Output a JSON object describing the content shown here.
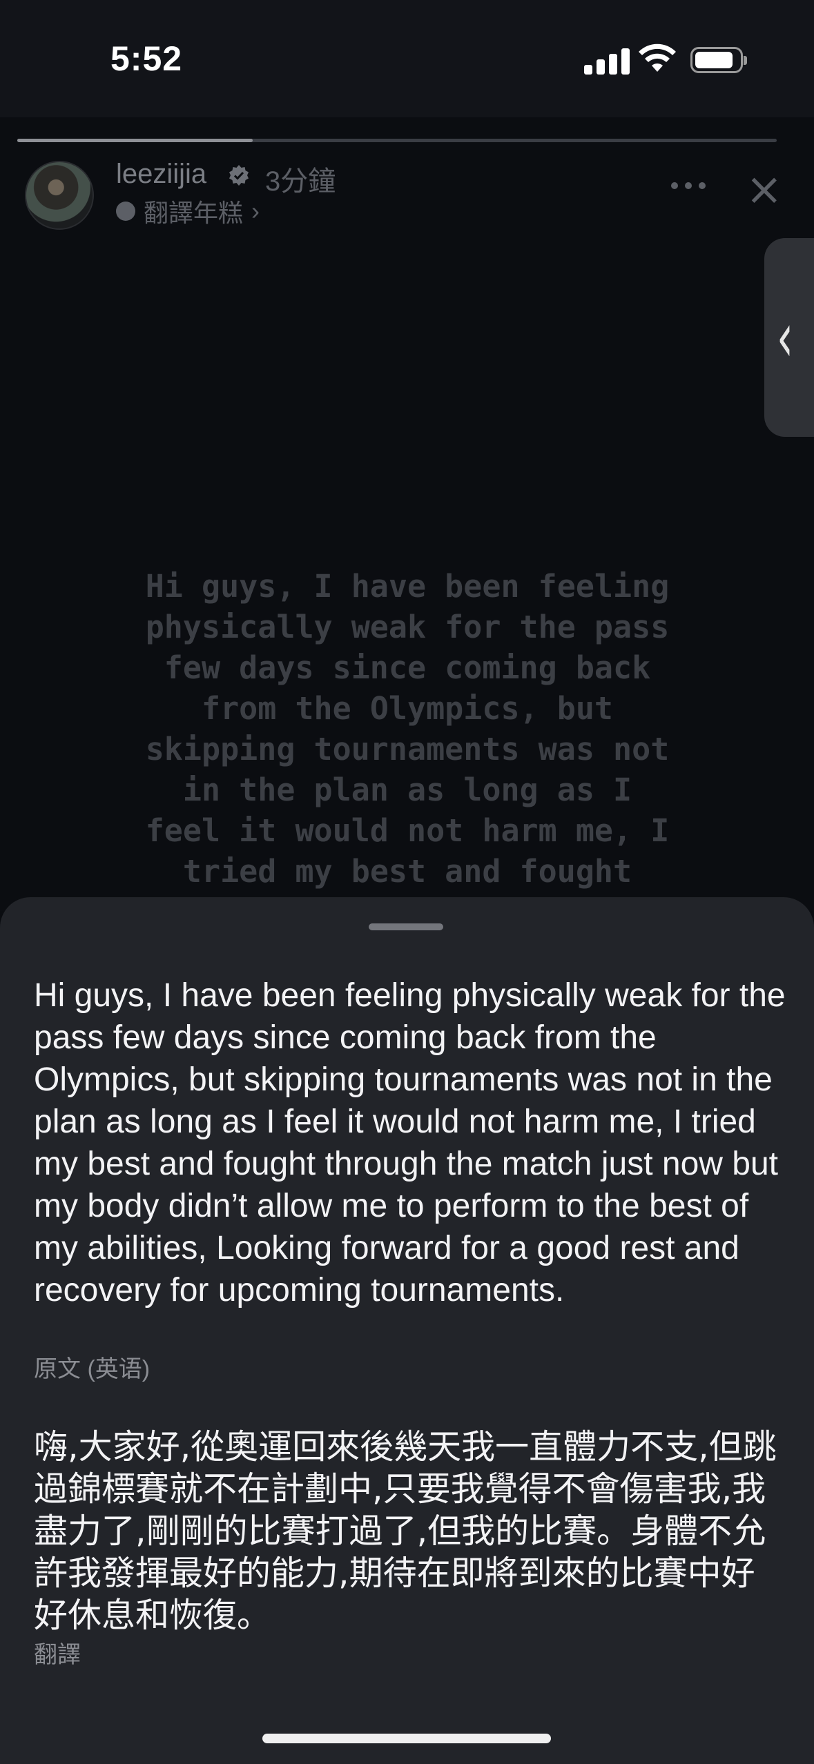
{
  "status_bar": {
    "time": "5:52",
    "icons": [
      "cellular-signal-icon",
      "wifi-icon",
      "battery-icon"
    ]
  },
  "story": {
    "progress": 0.31,
    "username": "leeziijia",
    "verified": true,
    "time_ago": "3分鐘",
    "audio_label": "翻譯年糕",
    "audio_chevron": "›",
    "close_symbol": "×",
    "side_tab_symbol": "‹",
    "text": "Hi guys, I have been feeling\nphysically weak for the pass\nfew days since coming back\nfrom the Olympics, but\nskipping tournaments was not\nin the plan as long as I\nfeel it would not harm me, I\ntried my best and fought"
  },
  "sheet": {
    "original_text": "Hi guys, I have been feeling physically weak for the pass few days since coming back from the Olympics, but skipping tournaments was not in the plan as long as I feel it would not harm me, I tried my best and fought through the match just now but my body didn’t allow me to perform to the best of my abilities, Looking forward for a good rest and recovery for upcoming tournaments.",
    "original_label": "原文 (英语)",
    "translated_text": "嗨,大家好,從奧運回來後幾天我一直體力不支,但跳過錦標賽就不在計劃中,只要我覺得不會傷害我,我盡力了,剛剛的比賽打過了,但我的比賽。身體不允許我發揮最好的能力,期待在即將到來的比賽中好好休息和恢復。",
    "translation_label": "翻譯"
  }
}
